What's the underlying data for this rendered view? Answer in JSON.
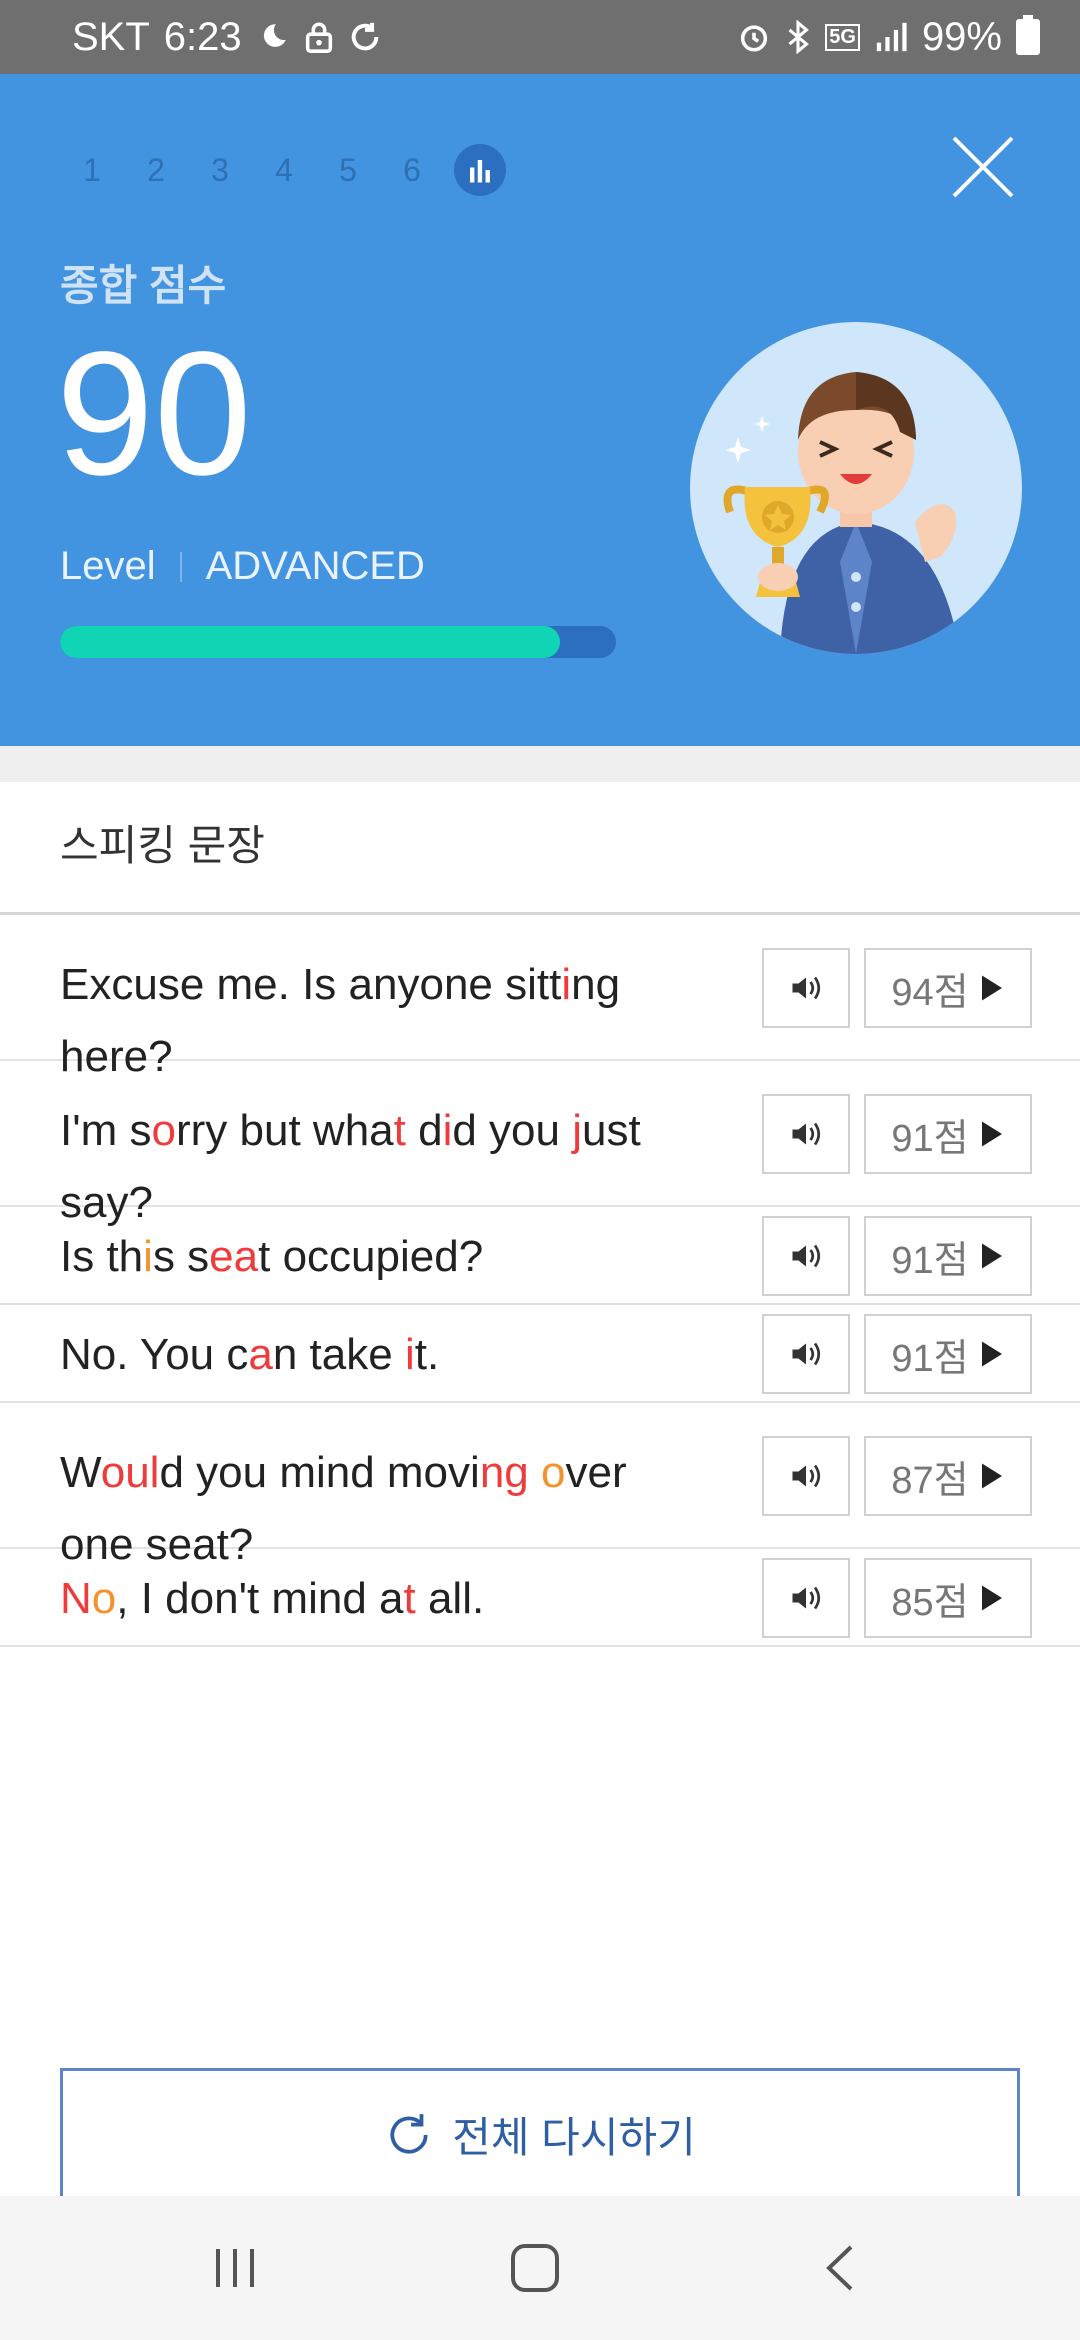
{
  "status_bar": {
    "carrier": "SKT",
    "time": "6:23",
    "battery": "99%",
    "network": "5G"
  },
  "header": {
    "steps": [
      "1",
      "2",
      "3",
      "4",
      "5",
      "6"
    ],
    "active_step_icon": "bar-chart-icon",
    "score_title": "종합 점수",
    "score": "90",
    "level_label": "Level",
    "level_value": "ADVANCED",
    "progress_percent": 90,
    "colors": {
      "background": "#4394e0",
      "progress": "#11d4b4"
    }
  },
  "section": {
    "title": "스피킹 문장"
  },
  "sentences": [
    {
      "parts": [
        [
          "Excuse me. Is anyone sitt",
          ""
        ],
        [
          "i",
          "red"
        ],
        [
          "ng here?",
          ""
        ]
      ],
      "score": "94점"
    },
    {
      "parts": [
        [
          "I'm s",
          ""
        ],
        [
          "o",
          "red"
        ],
        [
          "rry but wha",
          ""
        ],
        [
          "t",
          "red"
        ],
        [
          " d",
          ""
        ],
        [
          "i",
          "red"
        ],
        [
          "d you ",
          ""
        ],
        [
          "j",
          "red"
        ],
        [
          "ust say?",
          ""
        ]
      ],
      "score": "91점"
    },
    {
      "parts": [
        [
          "Is th",
          ""
        ],
        [
          "i",
          "orange"
        ],
        [
          "s s",
          ""
        ],
        [
          "ea",
          "red"
        ],
        [
          "t occupied?",
          ""
        ]
      ],
      "score": "91점"
    },
    {
      "parts": [
        [
          "No. You c",
          ""
        ],
        [
          "a",
          "red"
        ],
        [
          "n take ",
          ""
        ],
        [
          "i",
          "red"
        ],
        [
          "t.",
          ""
        ]
      ],
      "score": "91점"
    },
    {
      "parts": [
        [
          "W",
          ""
        ],
        [
          "oul",
          "red"
        ],
        [
          "d you mind movi",
          ""
        ],
        [
          "ng",
          "red"
        ],
        [
          " ",
          ""
        ],
        [
          "o",
          "orange"
        ],
        [
          "ver one seat?",
          ""
        ]
      ],
      "score": "87점"
    },
    {
      "parts": [
        [
          "N",
          "red"
        ],
        [
          "o",
          "orange"
        ],
        [
          ", I don't mind a",
          ""
        ],
        [
          "t",
          "red"
        ],
        [
          " all.",
          ""
        ]
      ],
      "score": "85점"
    }
  ],
  "retry_button": {
    "label": "전체 다시하기"
  },
  "nav": {
    "icons": [
      "recent-apps-icon",
      "home-icon",
      "back-icon"
    ]
  }
}
